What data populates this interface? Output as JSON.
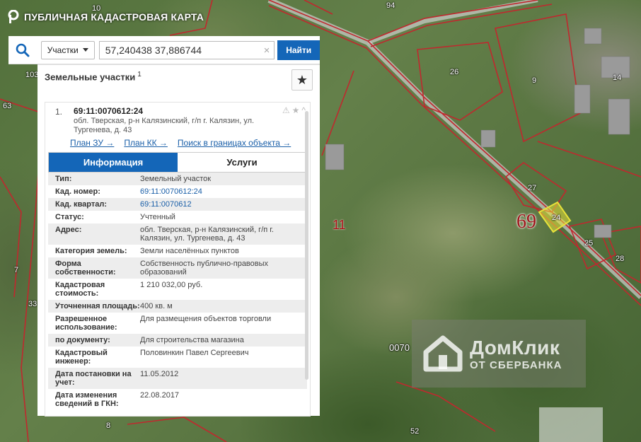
{
  "app": {
    "title": "ПУБЛИЧНАЯ КАДАСТРОВАЯ КАРТА"
  },
  "search": {
    "type_label": "Участки",
    "query": "57,240438 37,886744",
    "clear_glyph": "×",
    "button_label": "Найти"
  },
  "panel": {
    "title": "Земельные участки",
    "count": "1",
    "fav_glyph": "★"
  },
  "card": {
    "index": "1.",
    "cad_number": "69:11:0070612:24",
    "address": "обл. Тверская, р-н Калязинский, г/п г. Калязин, ул. Тургенева, д. 43",
    "icons": {
      "warn": "⚠",
      "star": "★",
      "collapse": "^"
    },
    "links": {
      "plan_zu": "План ЗУ →",
      "plan_kk": "План КК →",
      "search_bounds": "Поиск в границах объекта →"
    },
    "tabs": {
      "info": "Информация",
      "services": "Услуги"
    },
    "rows": [
      {
        "key": "Тип:",
        "value": "Земельный участок"
      },
      {
        "key": "Кад. номер:",
        "value": "69:11:0070612:24"
      },
      {
        "key": "Кад. квартал:",
        "value": "69:11:0070612"
      },
      {
        "key": "Статус:",
        "value": "Учтенный"
      },
      {
        "key": "Адрес:",
        "value": "обл. Тверская, р-н Калязинский, г/п г. Калязин, ул. Тургенева, д. 43"
      },
      {
        "key": "Категория земель:",
        "value": "Земли населённых пунктов"
      },
      {
        "key": "Форма собственности:",
        "value": "Собственность публично-правовых образований"
      },
      {
        "key": "Кадастровая стоимость:",
        "value": "1 210 032,00 руб."
      },
      {
        "key": "Уточненная площадь:",
        "value": "400 кв. м"
      },
      {
        "key": "Разрешенное использование:",
        "value": "Для размещения объектов торговли"
      },
      {
        "key": "по документу:",
        "value": "Для строительства магазина"
      },
      {
        "key": "Кадастровый инженер:",
        "value": "Половинкин Павел Сергеевич"
      },
      {
        "key": "Дата постановки на учет:",
        "value": "11.05.2012"
      },
      {
        "key": "Дата изменения сведений в ГКН:",
        "value": "22.08.2017"
      }
    ]
  },
  "map": {
    "region_code": "69",
    "district_code": "11",
    "quarter_code": "0070",
    "parcel_labels": [
      "94",
      "26",
      "9",
      "14",
      "27",
      "24",
      "25",
      "28",
      "52",
      "8",
      "10",
      "63",
      "33",
      "103",
      "7"
    ],
    "colors": {
      "boundary": "#c0282e",
      "highlight": "#e8e23a",
      "road": "#d8d8d8"
    }
  },
  "watermark": {
    "line1": "ДомКлик",
    "line2": "ОТ СБЕРБАНКА"
  }
}
